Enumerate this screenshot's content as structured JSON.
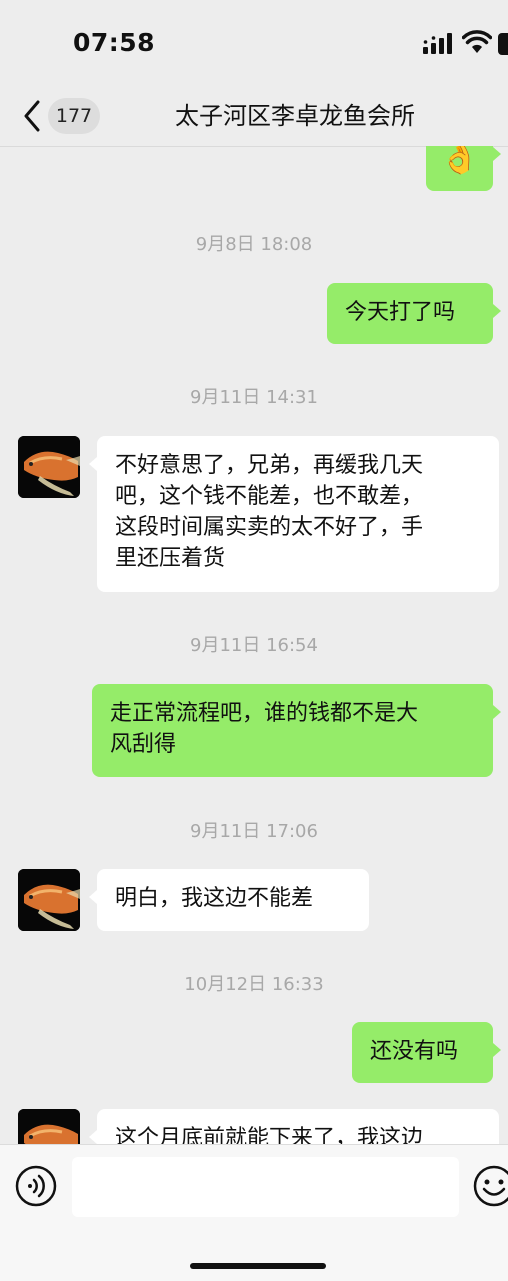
{
  "status_bar": {
    "time": "07:58"
  },
  "header": {
    "unread_count": "177",
    "title": "太子河区李卓龙鱼会所"
  },
  "messages": [
    {
      "type": "emoji",
      "sender": "me",
      "emoji": "👌"
    },
    {
      "type": "timestamp",
      "text": "9月8日 18:08"
    },
    {
      "type": "text",
      "sender": "me",
      "text": "今天打了吗"
    },
    {
      "type": "timestamp",
      "text": "9月11日 14:31"
    },
    {
      "type": "text",
      "sender": "them",
      "lines": [
        "不好意思了，兄弟，再缓我几天",
        "吧，这个钱不能差，也不敢差，",
        "这段时间属实卖的太不好了，手",
        "里还压着货"
      ]
    },
    {
      "type": "timestamp",
      "text": "9月11日 16:54"
    },
    {
      "type": "text",
      "sender": "me",
      "lines": [
        "走正常流程吧，谁的钱都不是大",
        "风刮得"
      ]
    },
    {
      "type": "timestamp",
      "text": "9月11日 17:06"
    },
    {
      "type": "text",
      "sender": "them",
      "text": "明白，我这边不能差"
    },
    {
      "type": "timestamp",
      "text": "10月12日 16:33"
    },
    {
      "type": "text",
      "sender": "me",
      "text": "还没有吗"
    },
    {
      "type": "text",
      "sender": "them",
      "text": "这个月底前就能下来了，我这边"
    }
  ],
  "colors": {
    "my_bubble": "#95EC69",
    "their_bubble": "#FFFFFF",
    "background": "#EDEDED",
    "timestamp": "#A8A8A8"
  },
  "icons": {
    "back": "chevron-left-icon",
    "voice": "voice-icon",
    "emoji": "smiley-icon",
    "avatar": "arowana-fish-avatar"
  }
}
